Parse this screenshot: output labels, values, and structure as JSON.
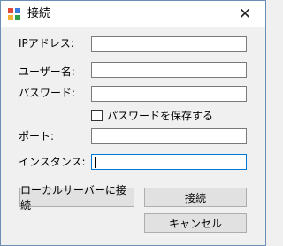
{
  "window": {
    "title": "接続",
    "close_glyph": "✕"
  },
  "form": {
    "ip_label": "IPアドレス:",
    "ip_value": "",
    "user_label": "ユーザー名:",
    "user_value": "",
    "password_label": "パスワード:",
    "password_value": "",
    "save_password_label": "パスワードを保存する",
    "save_password_checked": false,
    "port_label": "ポート:",
    "port_value": "",
    "instance_label": "インスタンス:",
    "instance_value": ""
  },
  "buttons": {
    "local_connect": "ローカルサーバーに接続",
    "connect": "接続",
    "cancel": "キャンセル"
  },
  "colors": {
    "focus_border": "#0078d7",
    "window_bg": "#f0f0f0"
  }
}
